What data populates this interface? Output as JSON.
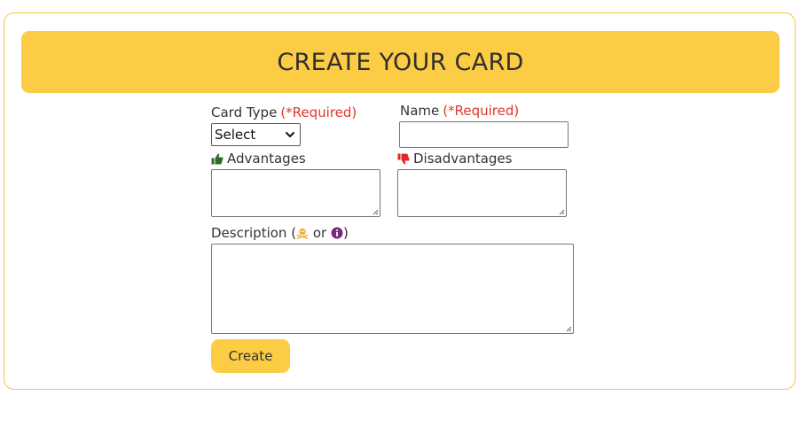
{
  "header": {
    "title": "CREATE YOUR CARD"
  },
  "form": {
    "card_type": {
      "label": "Card Type",
      "required_note": "(*Required)",
      "selected": "Select"
    },
    "name": {
      "label": "Name",
      "required_note": "(*Required)",
      "value": ""
    },
    "advantages": {
      "label": "Advantages",
      "icon": "thumbs-up-icon",
      "value": ""
    },
    "disadvantages": {
      "label": "Disadvantages",
      "icon": "thumbs-down-icon",
      "value": ""
    },
    "description": {
      "label_prefix": "Description (",
      "label_or": " or ",
      "label_suffix": ")",
      "icon_a": "skull-crossbones-icon",
      "icon_b": "info-circle-icon",
      "value": ""
    },
    "submit_label": "Create"
  },
  "colors": {
    "accent": "#fdcc45",
    "required": "#e0352b",
    "thumbs_up": "#2e6b2e",
    "thumbs_down": "#e0252b",
    "skull": "#f0b040",
    "info": "#7a2a7a"
  }
}
